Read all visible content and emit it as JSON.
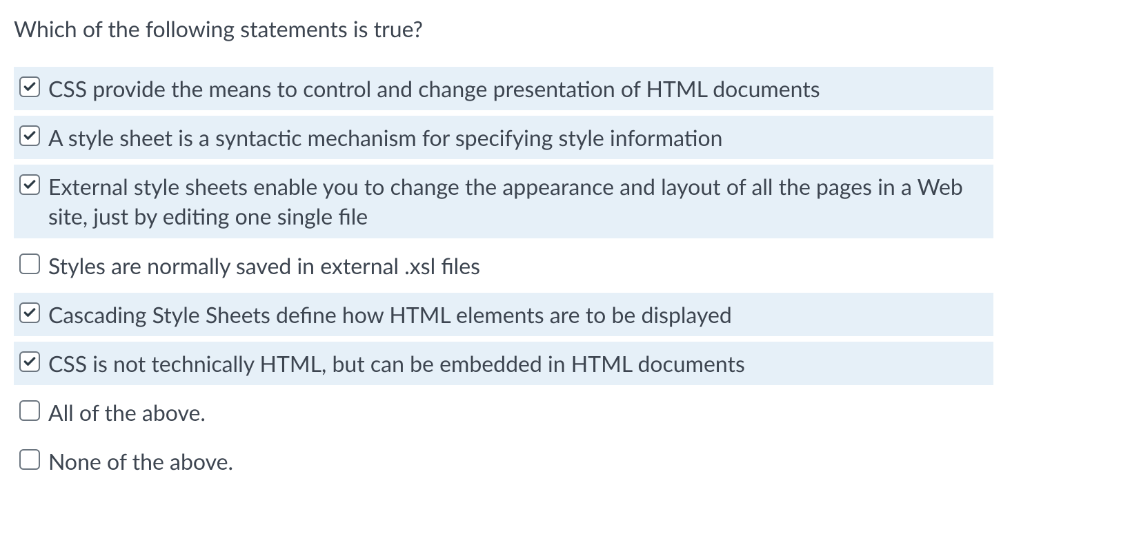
{
  "question": "Which of the following statements is true?",
  "options": [
    {
      "label": "CSS provide the means to control and change presentation of HTML documents",
      "checked": true
    },
    {
      "label": "A style sheet is a syntactic mechanism for specifying style information",
      "checked": true
    },
    {
      "label": "External style sheets enable you to change the appearance and layout of all the pages in a Web site, just by editing one single file",
      "checked": true
    },
    {
      "label": "Styles are normally saved in external .xsl files",
      "checked": false
    },
    {
      "label": "Cascading Style Sheets define how HTML elements are to be displayed",
      "checked": true
    },
    {
      "label": "CSS is not technically HTML, but can be embedded in HTML documents",
      "checked": true
    },
    {
      "label": "All of the above.",
      "checked": false
    },
    {
      "label": "None of the above.",
      "checked": false
    }
  ]
}
